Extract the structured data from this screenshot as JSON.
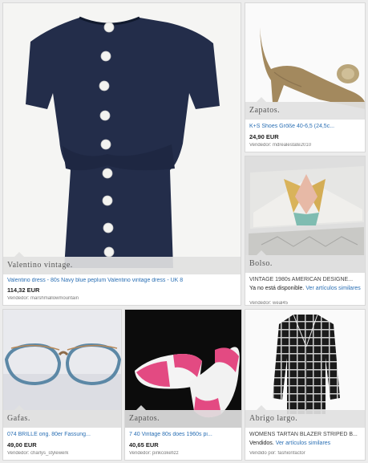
{
  "items": [
    {
      "category": "Valentino vintage.",
      "title": "Valentino dress - 80s Navy blue peplum Valentino vintage dress - UK 8",
      "price": "114,32 EUR",
      "seller_label": "Vendedor:",
      "seller": "marshmallowmountain"
    },
    {
      "category": "Zapatos.",
      "title": "K+S Shoes Größe 40-6,5 (24,5c...",
      "price": "24,90 EUR",
      "seller_label": "Vendedor:",
      "seller": "mdrealestate2010"
    },
    {
      "category": "Bolso.",
      "title": "VINTAGE 1980s AMERICAN DESIGNE...",
      "status": "Ya no está disponible.",
      "status_link": "Ver artículos similares",
      "seller_label": "Vendedor:",
      "seller": "weal45"
    },
    {
      "category": "Gafas.",
      "title": "074 BRILLE orig. 80er Fassung...",
      "price": "49,00 EUR",
      "seller_label": "Vendedor:",
      "seller": "charlys_stylewerk"
    },
    {
      "category": "Zapatos.",
      "title": "7 40 Vintage 80s does 1960s pi...",
      "price": "40,65 EUR",
      "seller_label": "Vendedor:",
      "seller": "pinkcokefizz"
    },
    {
      "category": "Abrigo largo.",
      "title": "WOMENS TARTAN BLAZER STRIPED B...",
      "status": "Vendidos.",
      "status_link": "Ver artículos similares",
      "seller_label": "Vendido por:",
      "seller": "fashionfactor"
    }
  ]
}
